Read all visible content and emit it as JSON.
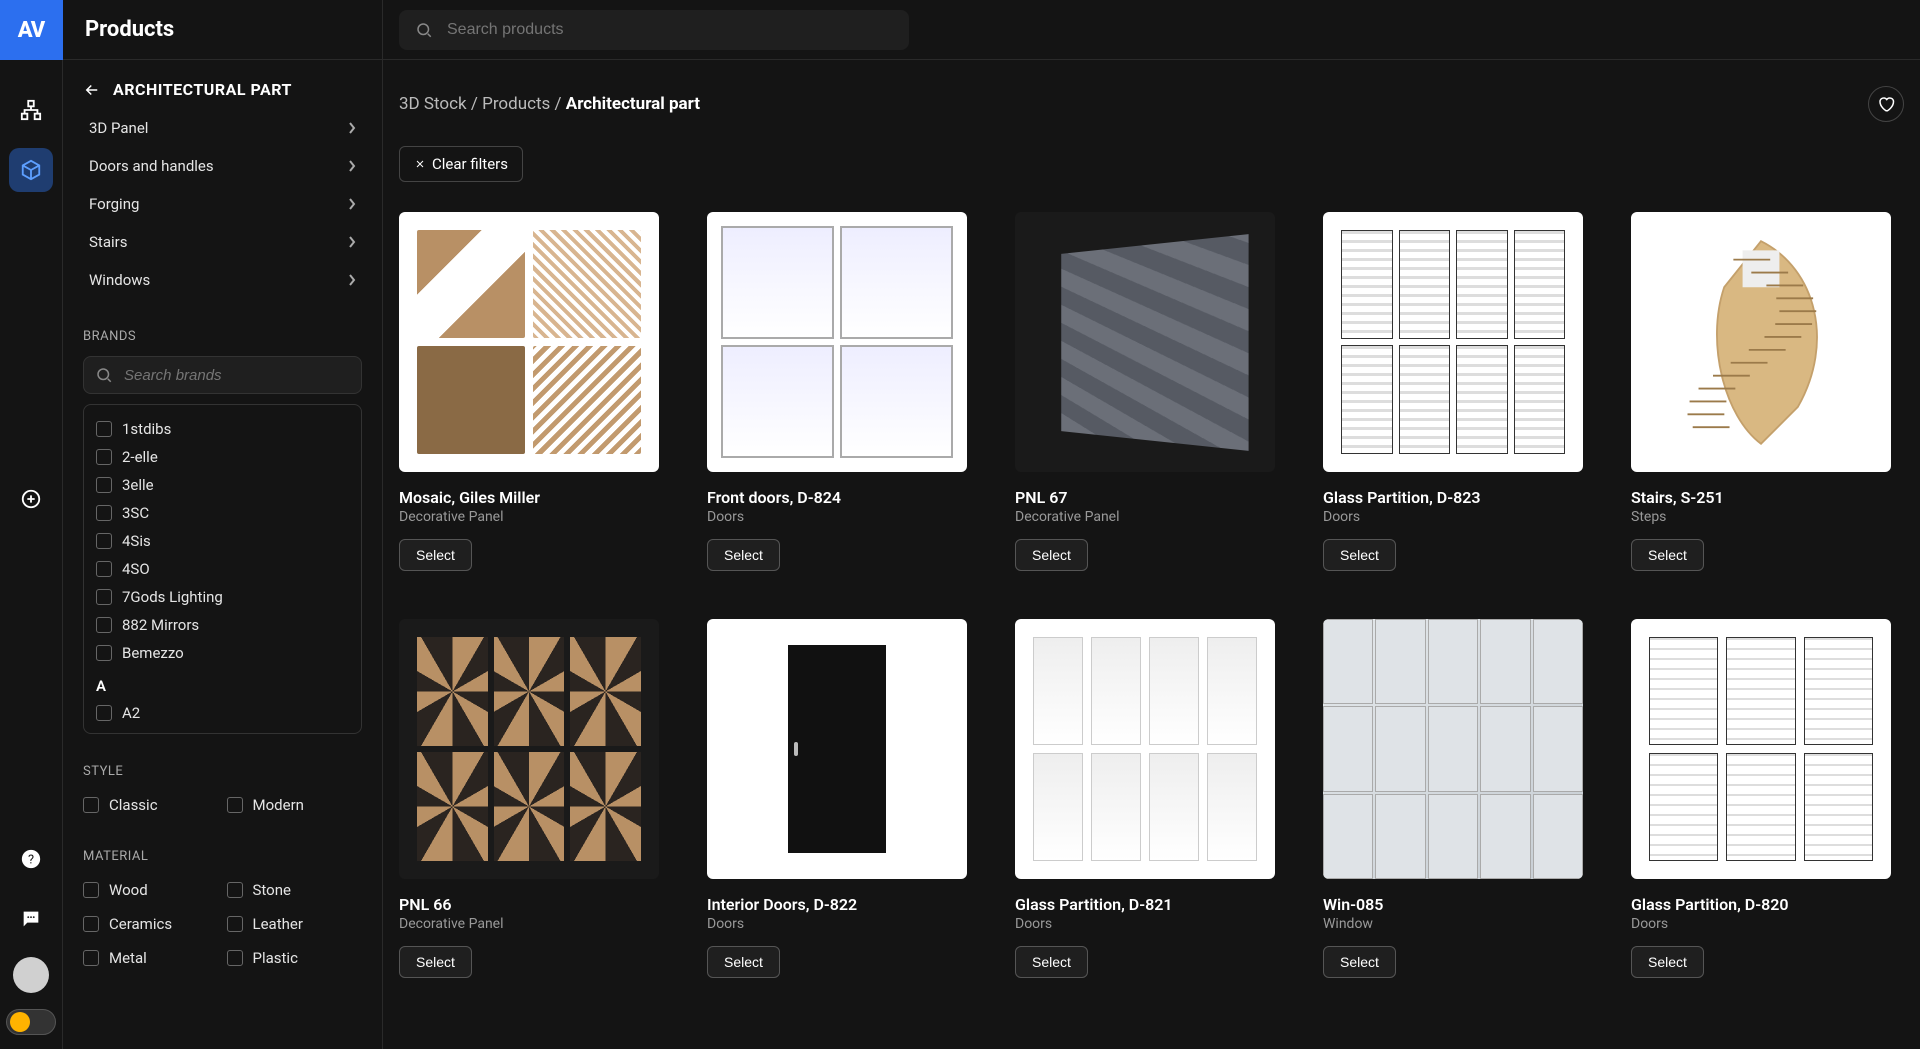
{
  "app": {
    "logo": "AV",
    "title": "Products"
  },
  "search": {
    "placeholder": "Search products"
  },
  "sidebar": {
    "back_label": "ARCHITECTURAL PART",
    "categories": [
      {
        "label": "3D Panel"
      },
      {
        "label": "Doors and handles"
      },
      {
        "label": "Forging"
      },
      {
        "label": "Stairs"
      },
      {
        "label": "Windows"
      }
    ],
    "brands_section_label": "BRANDS",
    "brand_search_placeholder": "Search brands",
    "brands": [
      "1stdibs",
      "2-elle",
      "3elle",
      "3SC",
      "4Sis",
      "4SO",
      "7Gods Lighting",
      "882 Mirrors",
      "Bemezzo"
    ],
    "brand_letter": "A",
    "brands_a": [
      "A2"
    ],
    "style_label": "STYLE",
    "styles": [
      "Classic",
      "Modern"
    ],
    "material_label": "MATERIAL",
    "materials_col1": [
      "Wood",
      "Ceramics",
      "Metal"
    ],
    "materials_col2": [
      "Stone",
      "Leather",
      "Plastic"
    ]
  },
  "breadcrumb": {
    "part1": "3D Stock",
    "part2": "Products",
    "current": "Architectural part",
    "sep": "/"
  },
  "clear_filters_label": "Clear filters",
  "select_label": "Select",
  "products": [
    {
      "title": "Mosaic, Giles Miller",
      "category": "Decorative Panel",
      "thumb": "mosaic"
    },
    {
      "title": "Front doors, D-824",
      "category": "Doors",
      "thumb": "frontdoors"
    },
    {
      "title": "PNL 67",
      "category": "Decorative Panel",
      "thumb": "pnl67"
    },
    {
      "title": "Glass Partition, D-823",
      "category": "Doors",
      "thumb": "glass823"
    },
    {
      "title": "Stairs, S-251",
      "category": "Steps",
      "thumb": "stairs"
    },
    {
      "title": "PNL 66",
      "category": "Decorative Panel",
      "thumb": "pnl66"
    },
    {
      "title": "Interior Doors, D-822",
      "category": "Doors",
      "thumb": "door822"
    },
    {
      "title": "Glass Partition, D-821",
      "category": "Doors",
      "thumb": "glass821"
    },
    {
      "title": "Win-085",
      "category": "Window",
      "thumb": "win085"
    },
    {
      "title": "Glass Partition, D-820",
      "category": "Doors",
      "thumb": "glass820"
    }
  ]
}
